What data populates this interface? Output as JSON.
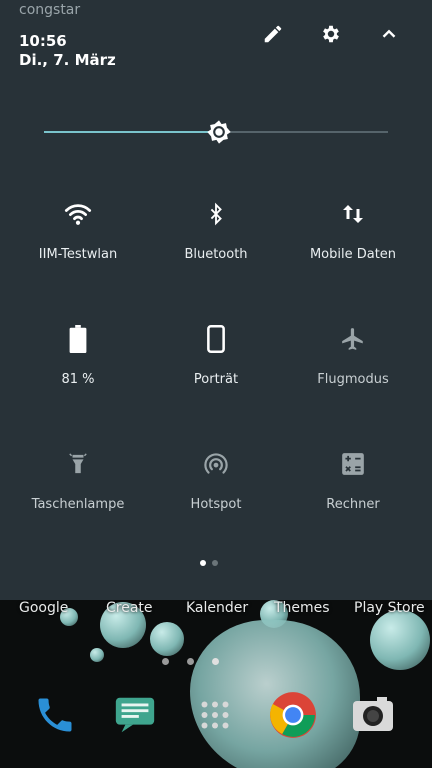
{
  "status": {
    "carrier": "congstar"
  },
  "header": {
    "time": "10:56",
    "date": "Di., 7. März"
  },
  "brightness": {
    "level_fraction": 0.51
  },
  "tiles": [
    {
      "label": "IIM-Testwlan",
      "icon": "wifi-icon",
      "active": true
    },
    {
      "label": "Bluetooth",
      "icon": "bluetooth-icon",
      "active": true
    },
    {
      "label": "Mobile Daten",
      "icon": "mobile-data-icon",
      "active": true
    },
    {
      "label": "81 %",
      "icon": "battery-icon",
      "active": true
    },
    {
      "label": "Porträt",
      "icon": "portrait-rotation-icon",
      "active": true
    },
    {
      "label": "Flugmodus",
      "icon": "airplane-icon",
      "active": false
    },
    {
      "label": "Taschenlampe",
      "icon": "flashlight-icon",
      "active": false
    },
    {
      "label": "Hotspot",
      "icon": "hotspot-icon",
      "active": false
    },
    {
      "label": "Rechner",
      "icon": "calculator-icon",
      "active": false
    }
  ],
  "page_dots": {
    "count": 2,
    "active_index": 0
  },
  "home": {
    "apps": [
      "Google",
      "Create",
      "Kalender",
      "Themes",
      "Play Store"
    ],
    "dock": [
      "phone-icon",
      "messages-icon",
      "app-drawer-icon",
      "chrome-icon",
      "camera-icon"
    ]
  },
  "colors": {
    "panel_bg": "#283238",
    "accent": "#7ac4cc",
    "inactive_icon": "#9aa4a8"
  }
}
